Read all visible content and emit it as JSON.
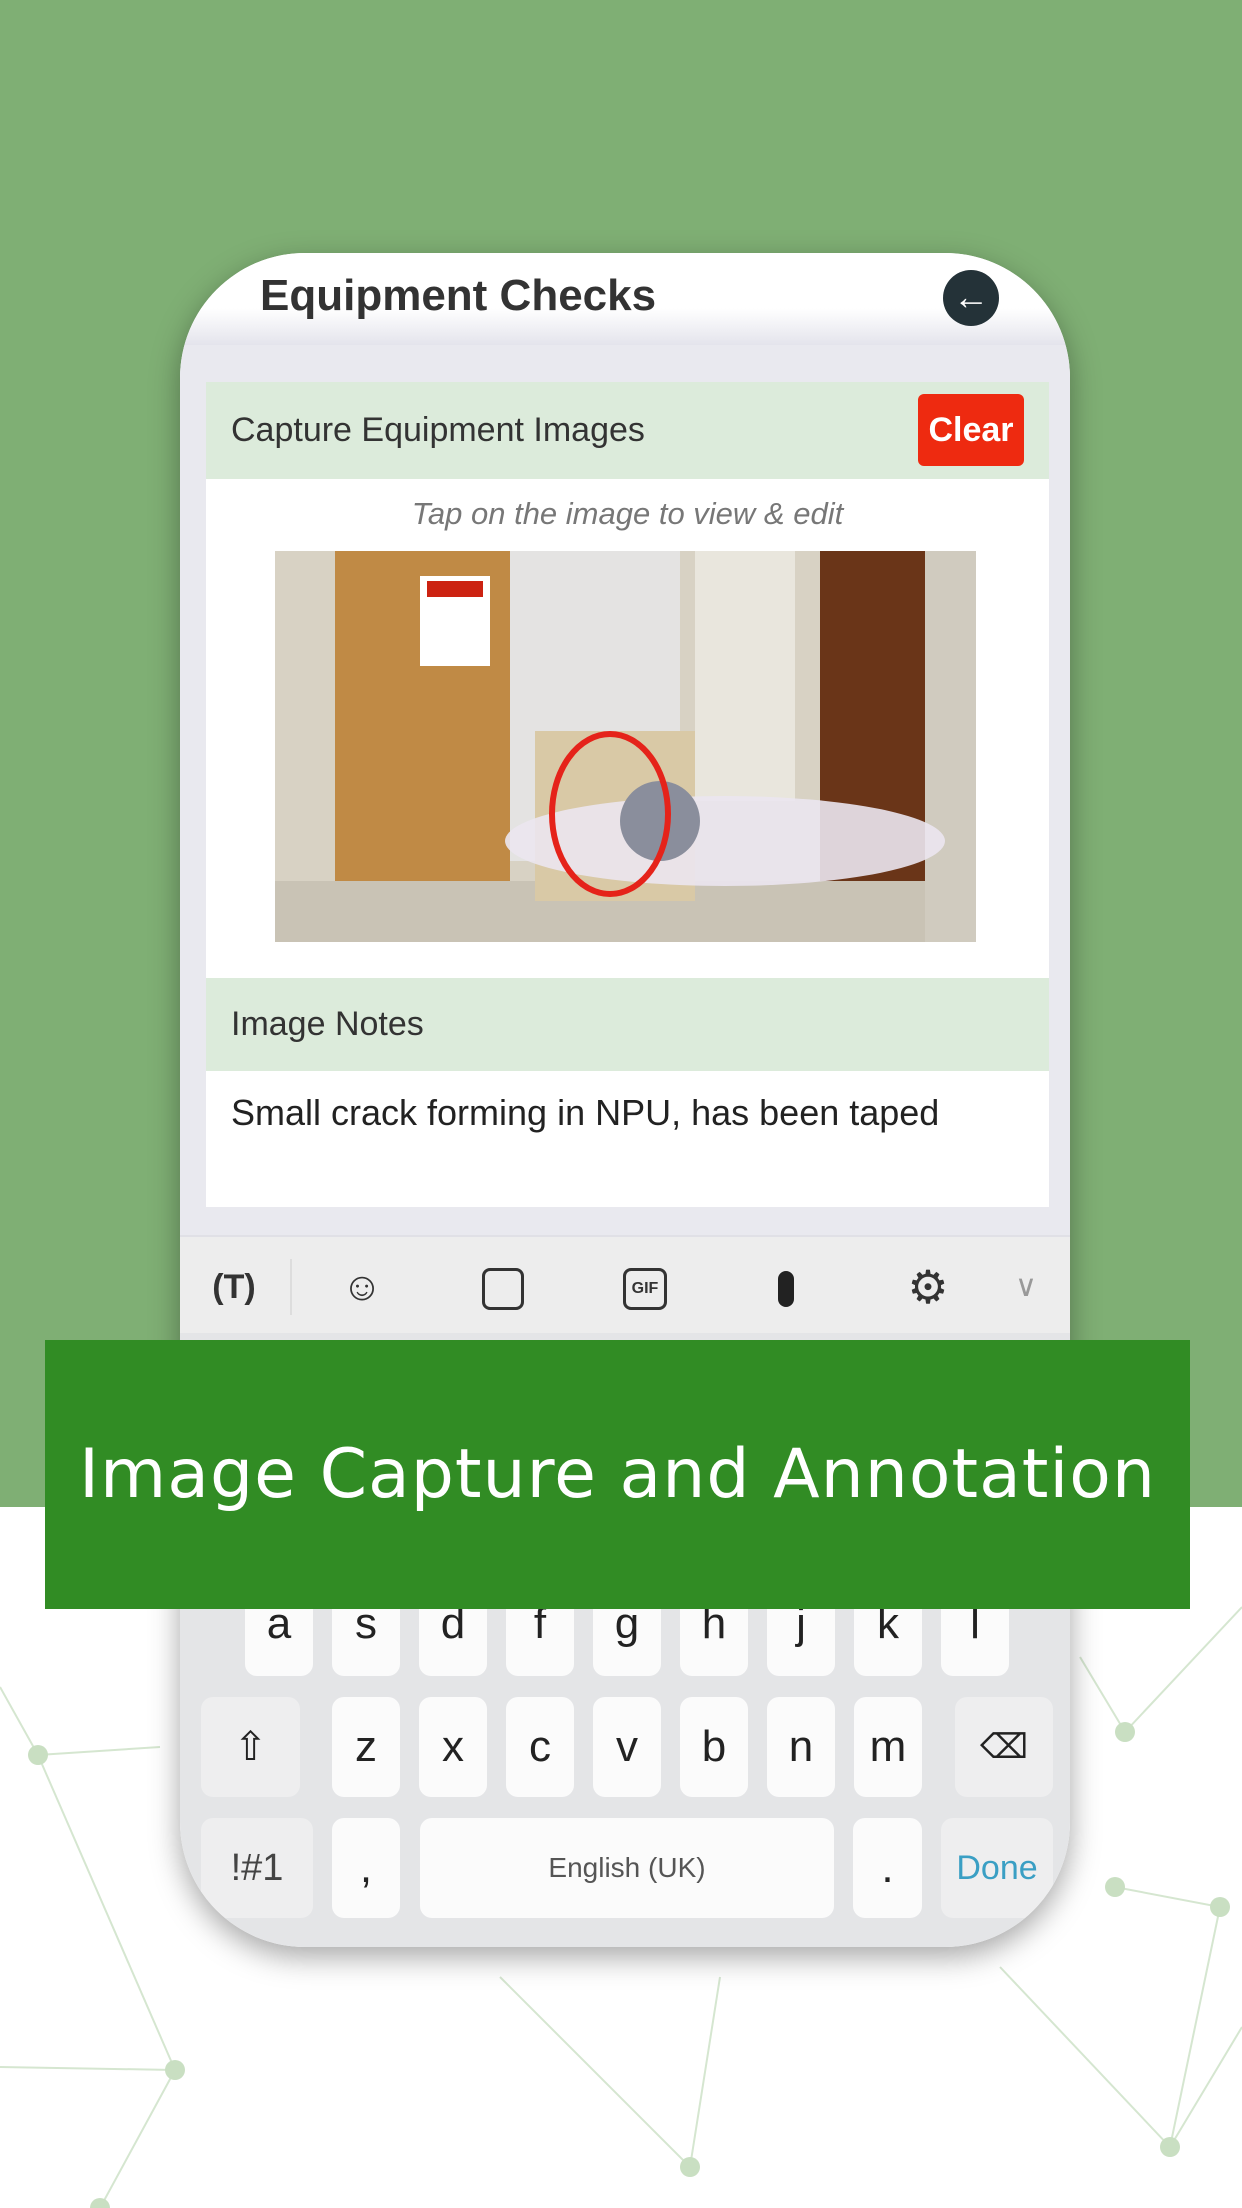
{
  "colors": {
    "background_green": "#7faf74",
    "banner_green": "#318c24",
    "clear_red": "#ee2a10",
    "section_bg": "#dcebdb",
    "done_blue": "#3a9fc4"
  },
  "header": {
    "title": "Equipment Checks",
    "back_icon": "arrow-left-icon"
  },
  "capture": {
    "label": "Capture Equipment Images",
    "clear_label": "Clear",
    "hint": "Tap on the image to view & edit"
  },
  "notes": {
    "label": "Image Notes",
    "value": "Small crack forming in NPU, has been taped"
  },
  "toolbar": {
    "icons": [
      "translate-icon",
      "emoji-icon",
      "sticker-icon",
      "gif-icon",
      "microphone-icon",
      "gear-icon",
      "chevron-down-icon"
    ],
    "gif_text": "GIF"
  },
  "keyboard": {
    "row2": [
      "a",
      "s",
      "d",
      "f",
      "g",
      "h",
      "j",
      "k",
      "l"
    ],
    "row3": [
      "z",
      "x",
      "c",
      "v",
      "b",
      "n",
      "m"
    ],
    "symbols": "!#1",
    "comma": ",",
    "space": "English (UK)",
    "period": ".",
    "done": "Done"
  },
  "banner": {
    "text": "Image Capture and Annotation"
  }
}
